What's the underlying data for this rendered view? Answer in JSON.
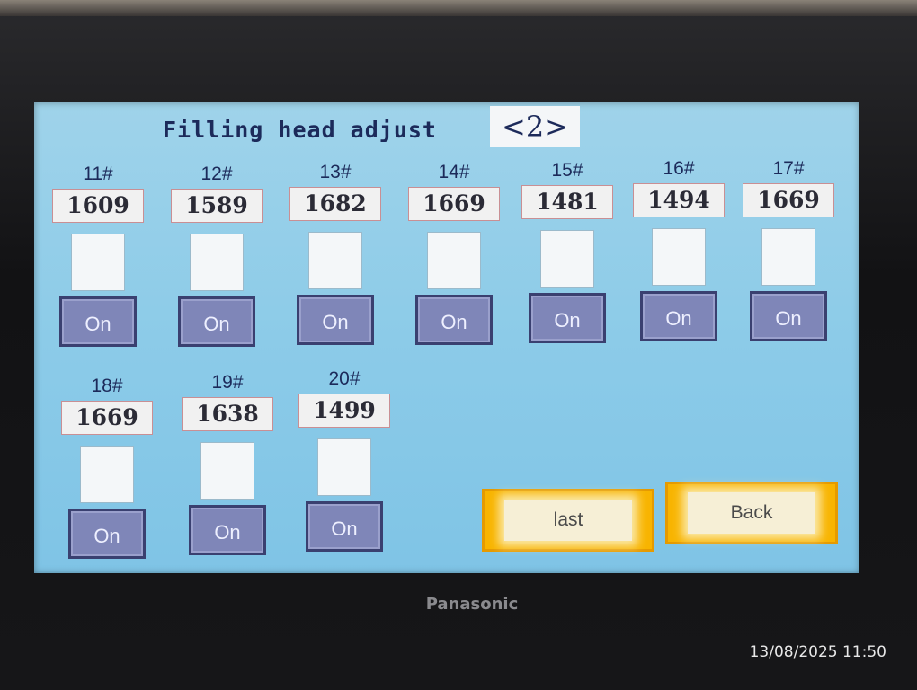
{
  "screen": {
    "title": "Filling head adjust",
    "page_indicator": "<2>"
  },
  "heads": [
    {
      "label": "11#",
      "value": "1609",
      "button": "On"
    },
    {
      "label": "12#",
      "value": "1589",
      "button": "On"
    },
    {
      "label": "13#",
      "value": "1682",
      "button": "On"
    },
    {
      "label": "14#",
      "value": "1669",
      "button": "On"
    },
    {
      "label": "15#",
      "value": "1481",
      "button": "On"
    },
    {
      "label": "16#",
      "value": "1494",
      "button": "On"
    },
    {
      "label": "17#",
      "value": "1669",
      "button": "On"
    },
    {
      "label": "18#",
      "value": "1669",
      "button": "On"
    },
    {
      "label": "19#",
      "value": "1638",
      "button": "On"
    },
    {
      "label": "20#",
      "value": "1499",
      "button": "On"
    }
  ],
  "nav": {
    "last_label": "last",
    "back_label": "Back",
    "accent_color": "#f8b400"
  },
  "device": {
    "brand": "Panasonic"
  },
  "photo_timestamp": "13/08/2025 11:50"
}
